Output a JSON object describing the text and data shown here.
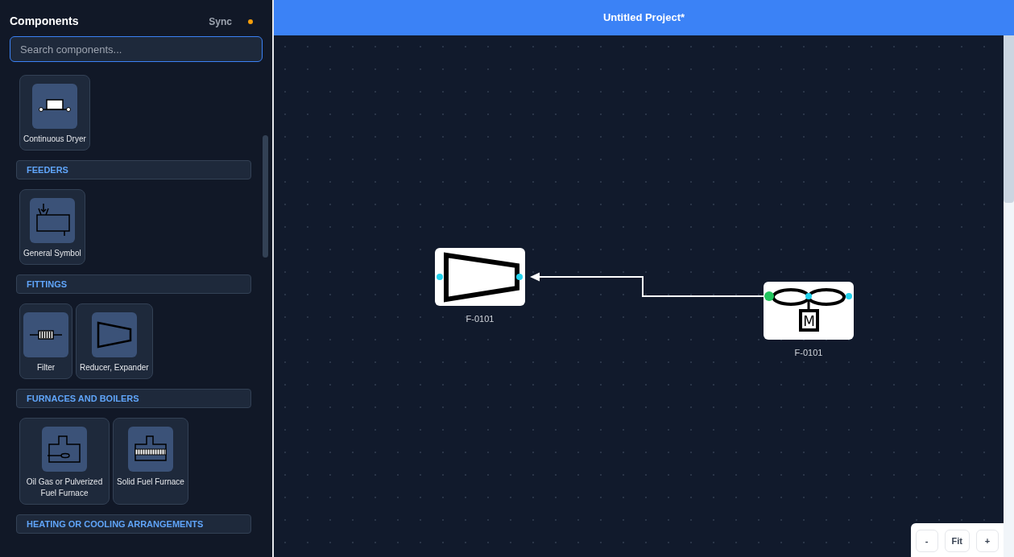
{
  "sidebar": {
    "title": "Components",
    "sync_label": "Sync",
    "search": {
      "placeholder": "Search components..."
    },
    "groups": [
      {
        "items": [
          {
            "label": "Continuous Dryer",
            "kind": "dryer"
          }
        ]
      },
      {
        "title": "FEEDERS",
        "items": [
          {
            "label": "General Symbol",
            "kind": "feeder"
          }
        ]
      },
      {
        "title": "FITTINGS",
        "items": [
          {
            "label": "Filter",
            "kind": "filter"
          },
          {
            "label": "Reducer, Expander",
            "kind": "reducer"
          }
        ]
      },
      {
        "title": "FURNACES AND BOILERS",
        "items": [
          {
            "label": "Oil Gas or Pulverized Fuel Furnace",
            "kind": "oil_furnace"
          },
          {
            "label": "Solid Fuel Furnace",
            "kind": "solid_furnace"
          }
        ]
      },
      {
        "title": "HEATING OR COOLING ARRANGEMENTS"
      }
    ]
  },
  "canvas": {
    "title": "Untitled Project*",
    "nodes": [
      {
        "label": "F-0101",
        "kind": "reducer"
      },
      {
        "label": "F-0101",
        "kind": "fan",
        "motor_label": "M"
      }
    ],
    "zoom_controls": [
      "-",
      "Fit",
      "+"
    ]
  }
}
